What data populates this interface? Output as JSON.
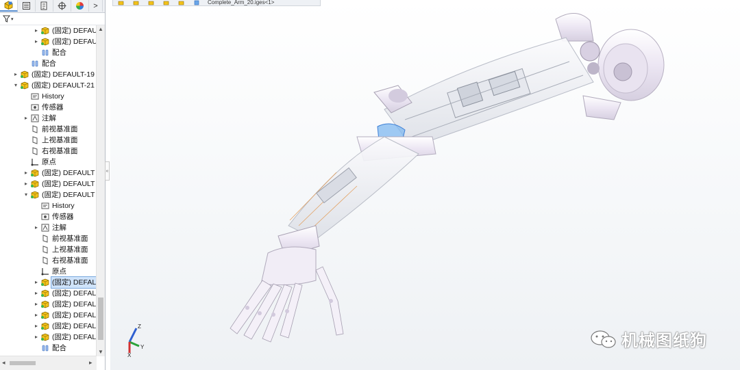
{
  "panel": {
    "tabs": [
      "feature-manager",
      "property-manager",
      "configuration-manager",
      "dimxpert-manager",
      "display-manager"
    ],
    "more_label": ">",
    "tree": [
      {
        "indent": 3,
        "expander": "▸",
        "icon": "part",
        "label": "(固定) DEFAUL"
      },
      {
        "indent": 3,
        "expander": "▸",
        "icon": "part",
        "label": "(固定) DEFAUL"
      },
      {
        "indent": 3,
        "expander": "",
        "icon": "mates",
        "label": "配合"
      },
      {
        "indent": 2,
        "expander": "",
        "icon": "mates",
        "label": "配合"
      },
      {
        "indent": 1,
        "expander": "▸",
        "icon": "part",
        "label": "(固定) DEFAULT-19"
      },
      {
        "indent": 1,
        "expander": "▾",
        "icon": "part",
        "label": "(固定) DEFAULT-21"
      },
      {
        "indent": 2,
        "expander": "",
        "icon": "history",
        "label": "History"
      },
      {
        "indent": 2,
        "expander": "",
        "icon": "sensor",
        "label": "传感器"
      },
      {
        "indent": 2,
        "expander": "▸",
        "icon": "annotation",
        "label": "注解"
      },
      {
        "indent": 2,
        "expander": "",
        "icon": "plane",
        "label": "前视基准面"
      },
      {
        "indent": 2,
        "expander": "",
        "icon": "plane",
        "label": "上视基准面"
      },
      {
        "indent": 2,
        "expander": "",
        "icon": "plane",
        "label": "右视基准面"
      },
      {
        "indent": 2,
        "expander": "",
        "icon": "origin",
        "label": "原点"
      },
      {
        "indent": 2,
        "expander": "▸",
        "icon": "part",
        "label": "(固定) DEFAULT"
      },
      {
        "indent": 2,
        "expander": "▸",
        "icon": "part",
        "label": "(固定) DEFAULT"
      },
      {
        "indent": 2,
        "expander": "▾",
        "icon": "part",
        "label": "(固定) DEFAULT"
      },
      {
        "indent": 3,
        "expander": "",
        "icon": "history",
        "label": "History"
      },
      {
        "indent": 3,
        "expander": "",
        "icon": "sensor",
        "label": "传感器"
      },
      {
        "indent": 3,
        "expander": "▸",
        "icon": "annotation",
        "label": "注解"
      },
      {
        "indent": 3,
        "expander": "",
        "icon": "plane",
        "label": "前视基准面"
      },
      {
        "indent": 3,
        "expander": "",
        "icon": "plane",
        "label": "上视基准面"
      },
      {
        "indent": 3,
        "expander": "",
        "icon": "plane",
        "label": "右视基准面"
      },
      {
        "indent": 3,
        "expander": "",
        "icon": "origin",
        "label": "原点"
      },
      {
        "indent": 3,
        "expander": "▸",
        "icon": "part",
        "label": "(固定) DEFAL",
        "selected": true
      },
      {
        "indent": 3,
        "expander": "▸",
        "icon": "part",
        "label": "(固定) DEFAL"
      },
      {
        "indent": 3,
        "expander": "▸",
        "icon": "part",
        "label": "(固定) DEFAL"
      },
      {
        "indent": 3,
        "expander": "▸",
        "icon": "part",
        "label": "(固定) DEFAL"
      },
      {
        "indent": 3,
        "expander": "▸",
        "icon": "part",
        "label": "(固定) DEFAL"
      },
      {
        "indent": 3,
        "expander": "▸",
        "icon": "part",
        "label": "(固定) DEFAL"
      },
      {
        "indent": 3,
        "expander": "",
        "icon": "mates",
        "label": "配合"
      }
    ]
  },
  "viewport": {
    "breadcrumb_text": "Complete_Arm_20.iges<1>",
    "triad": {
      "x": "X",
      "y": "Y",
      "z": "Z"
    },
    "watermark": "机械图纸狗"
  },
  "colors": {
    "selection": "#cfe3fa",
    "part_icon": "#e6b800",
    "arm_shell": "#f2eef8",
    "arm_highlight": "#7fb8f0"
  }
}
